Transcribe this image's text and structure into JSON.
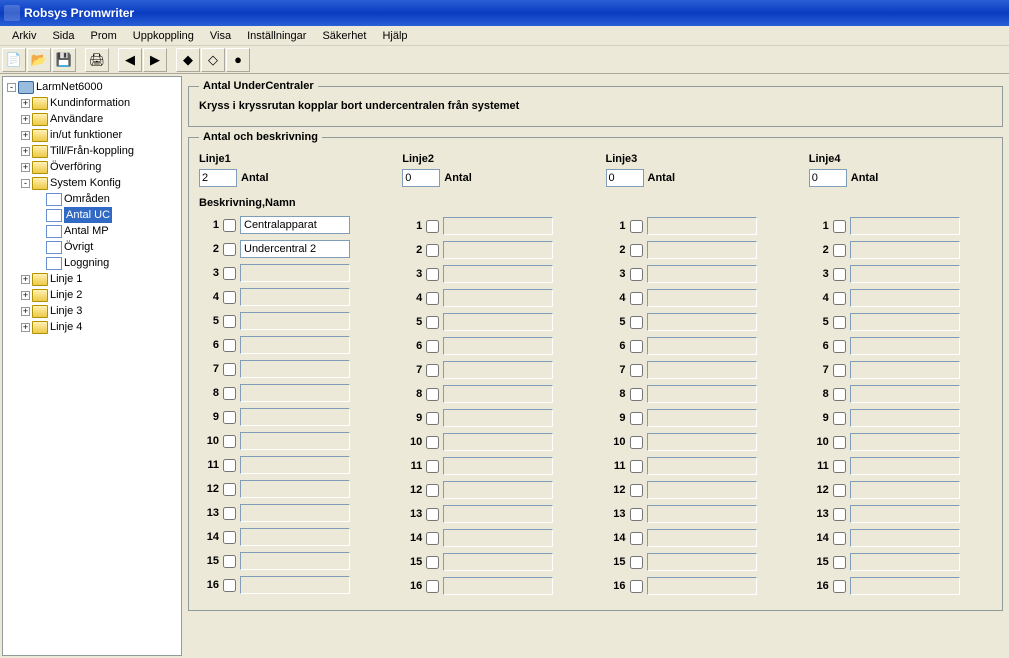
{
  "title": "Robsys Promwriter",
  "menu": [
    "Arkiv",
    "Sida",
    "Prom",
    "Uppkoppling",
    "Visa",
    "Inställningar",
    "Säkerhet",
    "Hjälp"
  ],
  "toolbar": {
    "btns": [
      "📄",
      "📂",
      "💾",
      "",
      "🖨",
      "",
      "◀",
      "▶",
      "",
      "◆",
      "◇",
      "●"
    ]
  },
  "tree": {
    "root": "LarmNet6000",
    "l1": [
      {
        "label": "Kundinformation",
        "exp": "+"
      },
      {
        "label": "Användare",
        "exp": "+"
      },
      {
        "label": "in/ut funktioner",
        "exp": "+"
      },
      {
        "label": "Till/Från-koppling",
        "exp": "+"
      },
      {
        "label": "Överföring",
        "exp": "+"
      },
      {
        "label": "System Konfig",
        "exp": "-",
        "open": true,
        "children": [
          {
            "label": "Områden"
          },
          {
            "label": "Antal UC",
            "selected": true
          },
          {
            "label": "Antal MP"
          },
          {
            "label": "Övrigt"
          },
          {
            "label": "Loggning"
          }
        ]
      },
      {
        "label": "Linje 1",
        "exp": "+"
      },
      {
        "label": "Linje 2",
        "exp": "+"
      },
      {
        "label": "Linje 3",
        "exp": "+"
      },
      {
        "label": "Linje 4",
        "exp": "+"
      }
    ]
  },
  "panel": {
    "group1_title": "Antal UnderCentraler",
    "hint": "Kryss i kryssrutan kopplar bort undercentralen från systemet",
    "group2_title": "Antal och beskrivning",
    "antal_label": "Antal",
    "beskr_label": "Beskrivning,Namn",
    "lines": [
      {
        "title": "Linje1",
        "antal": "2",
        "rows": [
          {
            "n": 1,
            "v": "Centralapparat",
            "filled": true
          },
          {
            "n": 2,
            "v": "Undercentral 2",
            "filled": true
          },
          {
            "n": 3,
            "v": ""
          },
          {
            "n": 4,
            "v": ""
          },
          {
            "n": 5,
            "v": ""
          },
          {
            "n": 6,
            "v": ""
          },
          {
            "n": 7,
            "v": ""
          },
          {
            "n": 8,
            "v": ""
          },
          {
            "n": 9,
            "v": ""
          },
          {
            "n": 10,
            "v": ""
          },
          {
            "n": 11,
            "v": ""
          },
          {
            "n": 12,
            "v": ""
          },
          {
            "n": 13,
            "v": ""
          },
          {
            "n": 14,
            "v": ""
          },
          {
            "n": 15,
            "v": ""
          },
          {
            "n": 16,
            "v": ""
          }
        ]
      },
      {
        "title": "Linje2",
        "antal": "0",
        "rows": [
          {
            "n": 1,
            "v": ""
          },
          {
            "n": 2,
            "v": ""
          },
          {
            "n": 3,
            "v": ""
          },
          {
            "n": 4,
            "v": ""
          },
          {
            "n": 5,
            "v": ""
          },
          {
            "n": 6,
            "v": ""
          },
          {
            "n": 7,
            "v": ""
          },
          {
            "n": 8,
            "v": ""
          },
          {
            "n": 9,
            "v": ""
          },
          {
            "n": 10,
            "v": ""
          },
          {
            "n": 11,
            "v": ""
          },
          {
            "n": 12,
            "v": ""
          },
          {
            "n": 13,
            "v": ""
          },
          {
            "n": 14,
            "v": ""
          },
          {
            "n": 15,
            "v": ""
          },
          {
            "n": 16,
            "v": ""
          }
        ]
      },
      {
        "title": "Linje3",
        "antal": "0",
        "rows": [
          {
            "n": 1,
            "v": ""
          },
          {
            "n": 2,
            "v": ""
          },
          {
            "n": 3,
            "v": ""
          },
          {
            "n": 4,
            "v": ""
          },
          {
            "n": 5,
            "v": ""
          },
          {
            "n": 6,
            "v": ""
          },
          {
            "n": 7,
            "v": ""
          },
          {
            "n": 8,
            "v": ""
          },
          {
            "n": 9,
            "v": ""
          },
          {
            "n": 10,
            "v": ""
          },
          {
            "n": 11,
            "v": ""
          },
          {
            "n": 12,
            "v": ""
          },
          {
            "n": 13,
            "v": ""
          },
          {
            "n": 14,
            "v": ""
          },
          {
            "n": 15,
            "v": ""
          },
          {
            "n": 16,
            "v": ""
          }
        ]
      },
      {
        "title": "Linje4",
        "antal": "0",
        "rows": [
          {
            "n": 1,
            "v": ""
          },
          {
            "n": 2,
            "v": ""
          },
          {
            "n": 3,
            "v": ""
          },
          {
            "n": 4,
            "v": ""
          },
          {
            "n": 5,
            "v": ""
          },
          {
            "n": 6,
            "v": ""
          },
          {
            "n": 7,
            "v": ""
          },
          {
            "n": 8,
            "v": ""
          },
          {
            "n": 9,
            "v": ""
          },
          {
            "n": 10,
            "v": ""
          },
          {
            "n": 11,
            "v": ""
          },
          {
            "n": 12,
            "v": ""
          },
          {
            "n": 13,
            "v": ""
          },
          {
            "n": 14,
            "v": ""
          },
          {
            "n": 15,
            "v": ""
          },
          {
            "n": 16,
            "v": ""
          }
        ]
      }
    ]
  }
}
